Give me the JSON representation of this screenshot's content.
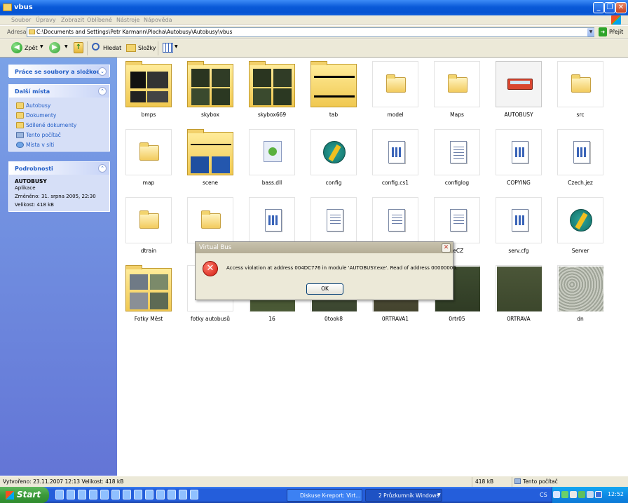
{
  "window": {
    "title": "vbus"
  },
  "menu": [
    "Soubor",
    "Úpravy",
    "Zobrazit",
    "Oblíbené",
    "Nástroje",
    "Nápověda"
  ],
  "address": {
    "label": "Adresa",
    "path": "C:\\Documents and Settings\\Petr Karmann\\Plocha\\Autobusy\\Autobusy\\vbus",
    "go": "Přejít"
  },
  "toolbar": {
    "back": "Zpět",
    "search": "Hledat",
    "folders": "Složky"
  },
  "tasks": {
    "file_tasks": {
      "title": "Práce se soubory a složkou"
    },
    "other_places": {
      "title": "Další místa",
      "items": [
        "Autobusy",
        "Dokumenty",
        "Sdílené dokumenty",
        "Tento počítač",
        "Místa v síti"
      ]
    },
    "details": {
      "title": "Podrobnosti",
      "name": "AUTOBUSY",
      "type": "Aplikace",
      "modified": "Změněno: 31. srpna 2005, 22:30",
      "size": "Velikost: 418 kB"
    }
  },
  "files": {
    "row1": [
      "bmps",
      "skybox",
      "skybox669",
      "tab",
      "model",
      "Maps",
      "AUTOBUSY",
      "src"
    ],
    "row2": [
      "map",
      "scene",
      "bass.dll",
      "config",
      "config.cs1",
      "configlog",
      "COPYING",
      "Czech.jez"
    ],
    "row3": [
      "dtrain",
      "",
      "",
      "",
      "",
      "meCZ",
      "serv.cfg",
      "Server"
    ],
    "row4": [
      "Fotky Měst",
      "fotky autobusů",
      "16",
      "0took8",
      "0RTRAVA1",
      "0rtr05",
      "0RTRAVA",
      "dn"
    ]
  },
  "dialog": {
    "title": "Virtual Bus",
    "message": "Access violation at address 004DC776 in module 'AUTOBUSY.exe'. Read of address 00000000.",
    "ok": "OK"
  },
  "status": {
    "info": "Vytvořeno: 23.11.2007 12:13 Velikost: 418 kB",
    "size": "418 kB",
    "location": "Tento počítač"
  },
  "taskbar": {
    "start": "Start",
    "task1": "Diskuse K-report: Virt...",
    "task2": "2 Průzkumník Windows",
    "lang": "CS",
    "time": "12:52"
  },
  "colors": {
    "title_blue": "#0553d2",
    "panel_blue": "#7ba2e7",
    "start_green": "#3c9a3a",
    "tray_blue": "#0f8be6"
  }
}
